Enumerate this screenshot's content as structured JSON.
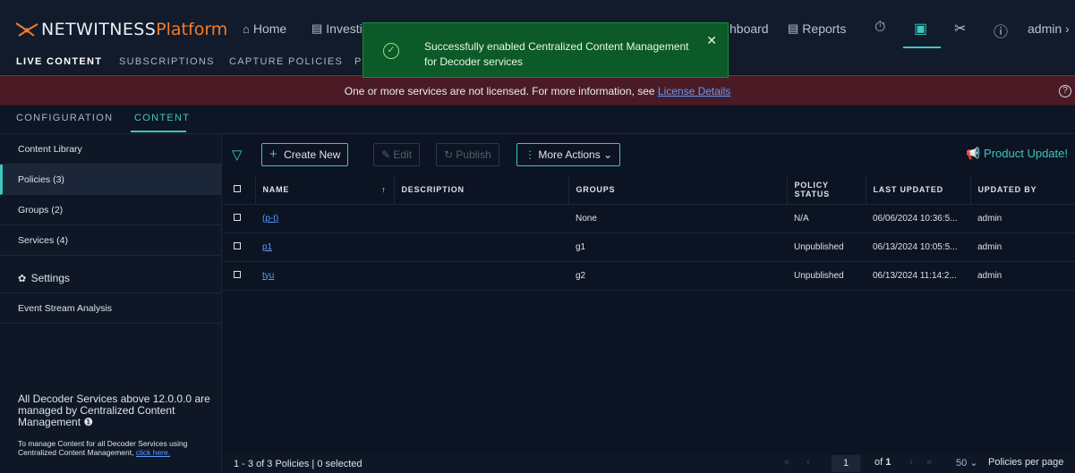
{
  "brand": {
    "name_part1": "NETWITNESS",
    "name_part2": "Platform"
  },
  "top_nav": {
    "home": "Home",
    "investigate": "Investi",
    "dashboard": "hboard",
    "reports": "Reports",
    "user": "admin"
  },
  "sub_nav": [
    "LIVE CONTENT",
    "SUBSCRIPTIONS",
    "CAPTURE POLICIES",
    "P"
  ],
  "banner": {
    "text": "One or more services are not licensed. For more information, see ",
    "link": "License Details"
  },
  "section_tabs": [
    "CONFIGURATION",
    "CONTENT"
  ],
  "sidebar": {
    "items": [
      {
        "label": "Content Library"
      },
      {
        "label": "Policies (3)"
      },
      {
        "label": "Groups (2)"
      },
      {
        "label": "Services (4)"
      },
      {
        "label": "Settings"
      },
      {
        "label": "Event Stream Analysis"
      }
    ],
    "note": "All Decoder Services above 12.0.0.0 are managed by Centralized Content Management",
    "note2": "To manage Content for all Decoder Services using Centralized Content Management, ",
    "note2_link": "click here."
  },
  "toolbar": {
    "create_new": "Create New",
    "edit": "Edit",
    "publish": "Publish",
    "more_actions": "More Actions",
    "product_update": "Product Update!"
  },
  "table": {
    "headers": [
      "NAME",
      "DESCRIPTION",
      "GROUPS",
      "POLICY STATUS",
      "LAST UPDATED",
      "UPDATED BY"
    ],
    "rows": [
      {
        "name": "(p-t)",
        "description": "",
        "groups": "None",
        "status": "N/A",
        "updated": "06/06/2024 10:36:5...",
        "by": "admin"
      },
      {
        "name": "p1",
        "description": "",
        "groups": "g1",
        "status": "Unpublished",
        "updated": "06/13/2024 10:05:5...",
        "by": "admin"
      },
      {
        "name": "tyu",
        "description": "",
        "groups": "g2",
        "status": "Unpublished",
        "updated": "06/13/2024 11:14:2...",
        "by": "admin"
      }
    ]
  },
  "footer": {
    "summary": "1 - 3 of 3 Policies | 0 selected",
    "page": "1",
    "of": "of",
    "total_pages": "1",
    "per_page": "50",
    "per_page_label": "Policies per page"
  },
  "toast": {
    "message": "Successfully enabled Centralized Content Management for Decoder services"
  },
  "colors": {
    "accent": "#3ec6c0",
    "brand_orange": "#f07b2e",
    "toast_bg": "#0b5a27",
    "banner_bg": "#4b1b25",
    "link": "#5b9cff"
  }
}
